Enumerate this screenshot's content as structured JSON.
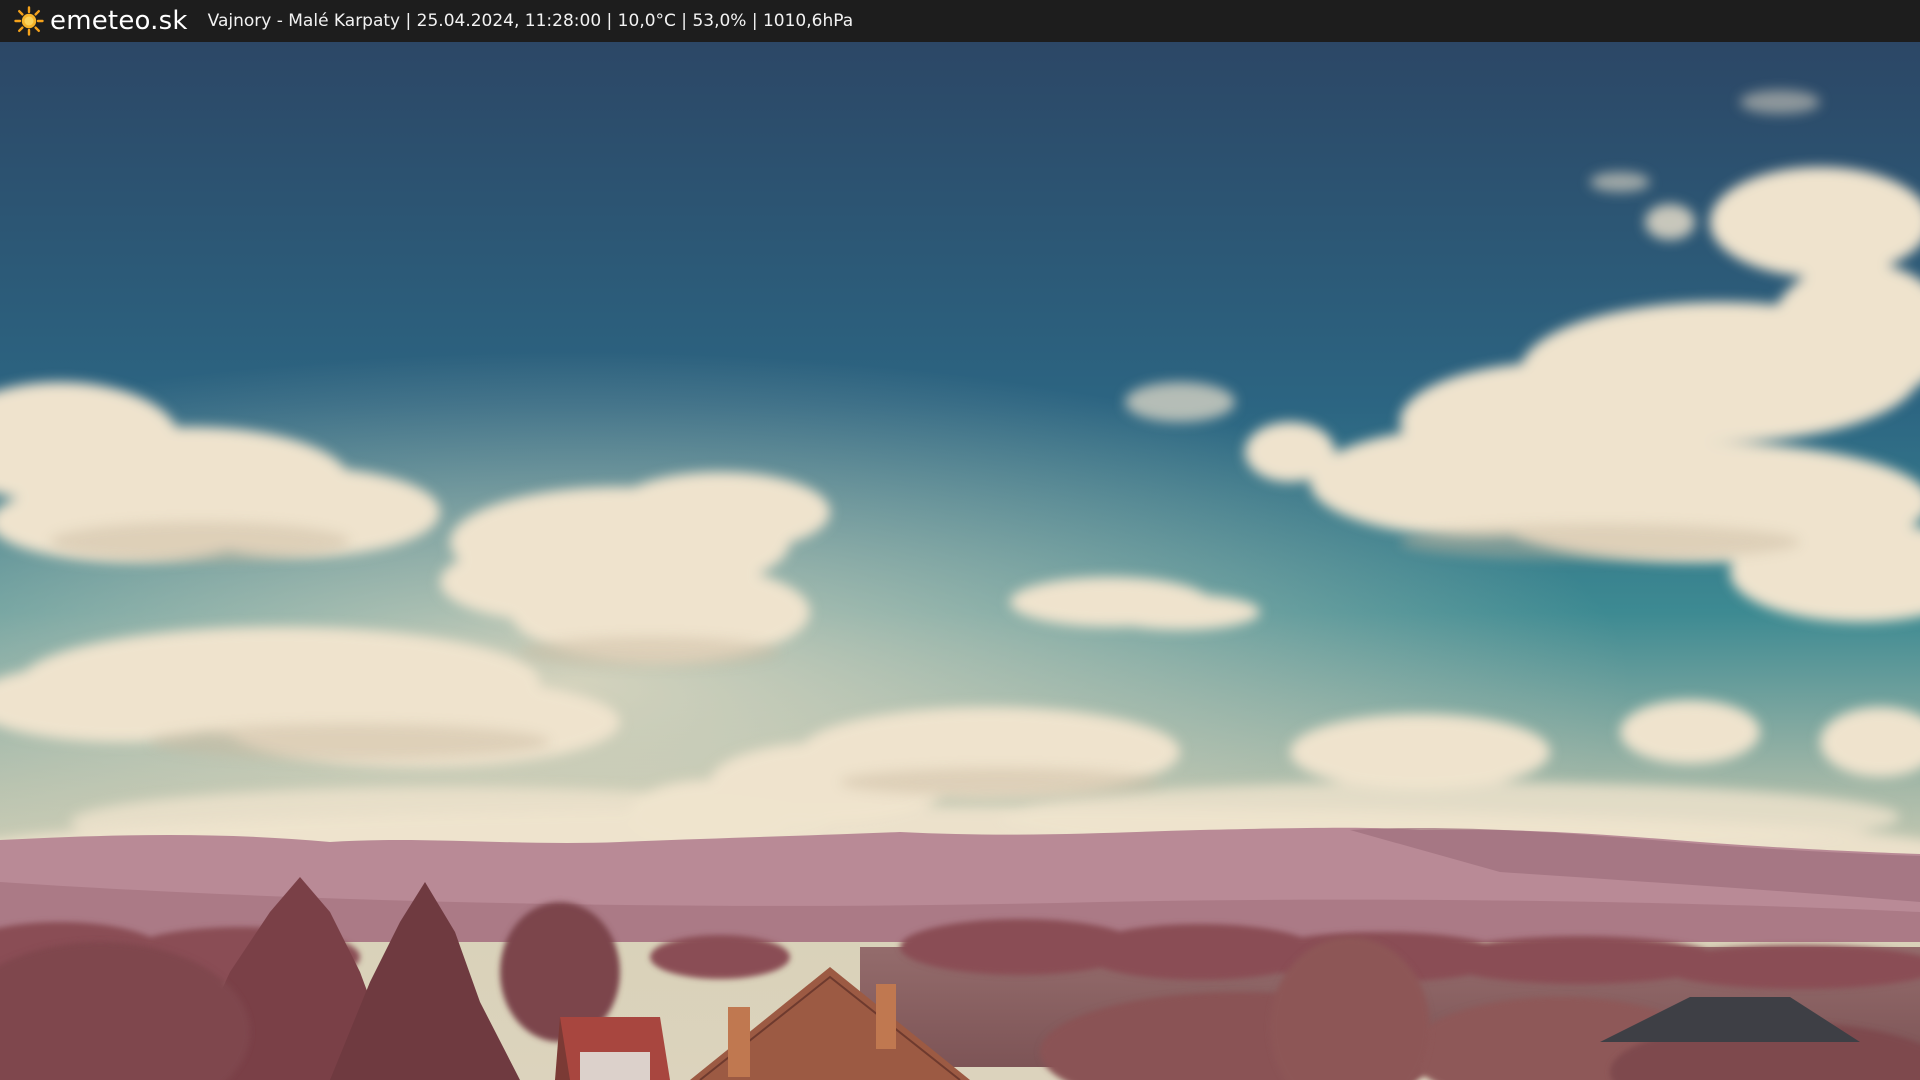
{
  "header": {
    "brand": "emeteo.sk",
    "logo_icon": "sun-icon",
    "info": "Vajnory - Malé Karpaty | 25.04.2024, 11:28:00 | 10,0°C | 53,0% | 1010,6hPa"
  },
  "colors": {
    "bar": "#1d1d1d",
    "sky_top": "#2d4a68",
    "sky_mid": "#2f7a8c",
    "horizon": "#d9d4b8",
    "clouds": "#efe2cc",
    "hills": "#b88994",
    "foliage": "#8a4b4e",
    "roofs": "#a45a44"
  }
}
